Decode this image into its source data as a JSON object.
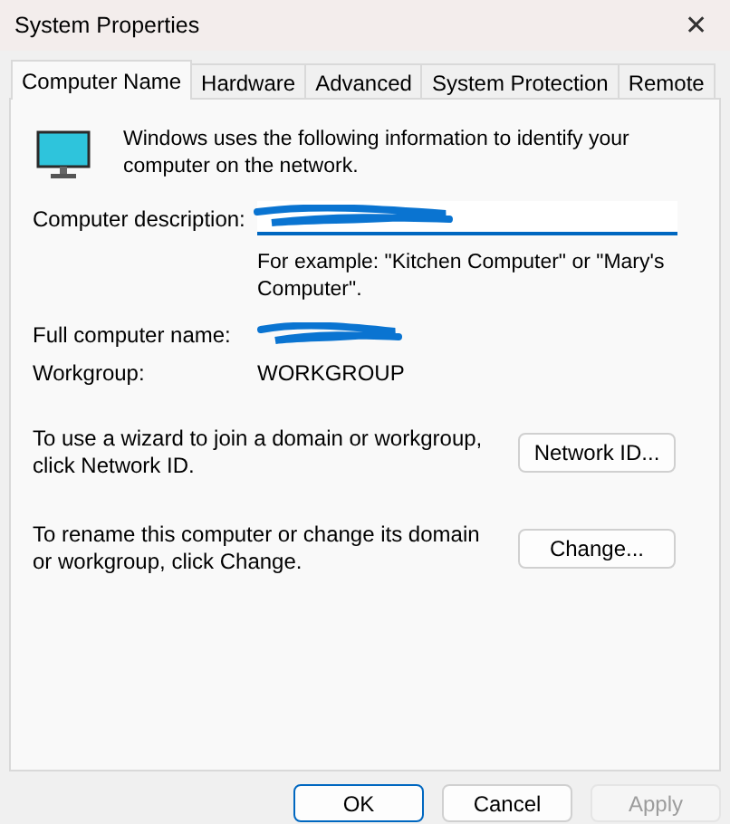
{
  "window": {
    "title": "System Properties",
    "close": "✕"
  },
  "tabs": [
    {
      "label": "Computer Name",
      "selected": true
    },
    {
      "label": "Hardware",
      "selected": false
    },
    {
      "label": "Advanced",
      "selected": false
    },
    {
      "label": "System Protection",
      "selected": false
    },
    {
      "label": "Remote",
      "selected": false
    }
  ],
  "intro": "Windows uses the following information to identify your computer on the network.",
  "description": {
    "label": "Computer description:",
    "redacted": true,
    "hint": "For example: \"Kitchen Computer\" or \"Mary's Computer\"."
  },
  "full_name": {
    "label": "Full computer name:",
    "redacted": true
  },
  "workgroup": {
    "label": "Workgroup:",
    "value": "WORKGROUP"
  },
  "actions": [
    {
      "text": "To use a wizard to join a domain or workgroup, click Network ID.",
      "button": "Network ID..."
    },
    {
      "text": "To rename this computer or change its domain or workgroup, click Change.",
      "button": "Change..."
    }
  ],
  "buttons": [
    {
      "label": "OK",
      "default": true,
      "disabled": false
    },
    {
      "label": "Cancel",
      "default": false,
      "disabled": false
    },
    {
      "label": "Apply",
      "default": false,
      "disabled": true
    }
  ]
}
